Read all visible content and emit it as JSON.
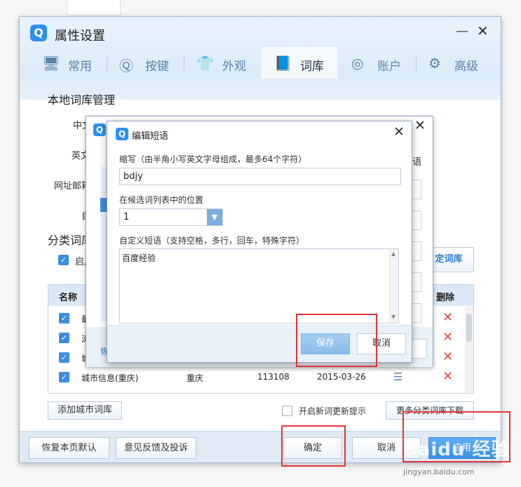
{
  "window": {
    "title": "属性设置",
    "logo": "Q",
    "minimize_glyph": "—",
    "close_glyph": "✕"
  },
  "tabs": [
    {
      "label": "常用",
      "icon": "monitor-icon",
      "glyph": "🖥"
    },
    {
      "label": "按键",
      "icon": "q-key-icon",
      "glyph": "Ⓠ"
    },
    {
      "label": "外观",
      "icon": "tshirt-icon",
      "glyph": "👕"
    },
    {
      "label": "词库",
      "icon": "book-icon",
      "glyph": "📘"
    },
    {
      "label": "账户",
      "icon": "user-icon",
      "glyph": "◎"
    },
    {
      "label": "高级",
      "icon": "gear-icon",
      "glyph": "⚙"
    }
  ],
  "active_tab": "词库",
  "local_lib": {
    "heading": "本地词库管理",
    "rows": [
      "中文",
      "英文",
      "网址邮箱",
      "自"
    ]
  },
  "class_lib": {
    "heading": "分类词库",
    "enable_label": "启用",
    "custom_button": "定词库",
    "columns": [
      "名称",
      "删除"
    ],
    "rows": [
      {
        "name": "最",
        "region": "",
        "count": "",
        "date": ""
      },
      {
        "name": "流",
        "region": "",
        "count": "",
        "date": ""
      },
      {
        "name": "城",
        "region": "",
        "count": "",
        "date": ""
      },
      {
        "name": "城市信息(重庆)",
        "region": "重庆",
        "count": "113108",
        "date": "2015-03-26"
      }
    ],
    "add_city_button": "添加城市词库",
    "new_word_hint": "开启新词更新提示",
    "more_download_button": "更多分类词库下载"
  },
  "footer": {
    "restore_button": "恢复本页默认",
    "feedback_button": "意见反馈及投诉",
    "ok_button": "确定",
    "cancel_button": "取消",
    "apply_button": "应用"
  },
  "back_dialog": {
    "logo": "Q",
    "close_glyph": "✕",
    "partial_text": "语",
    "restore_link": "恢"
  },
  "phrase_dialog": {
    "title": "编辑短语",
    "logo": "Q",
    "close_glyph": "✕",
    "abbr_label": "缩写（由半角小写英文字母组成，最多64个字符）",
    "abbr_value": "bdjy",
    "position_label": "在候选词列表中的位置",
    "position_value": "1",
    "phrase_label": "自定义短语（支持空格，多行，回车，特殊字符）",
    "phrase_value": "百度经验",
    "save_button": "保存",
    "cancel_button": "取消"
  },
  "watermark": {
    "brand": "Baidu 经验",
    "url": "jingyan.baidu.com"
  },
  "colors": {
    "accent": "#3c8de2",
    "annotation": "#e5343a",
    "delete": "#e04a3f"
  }
}
